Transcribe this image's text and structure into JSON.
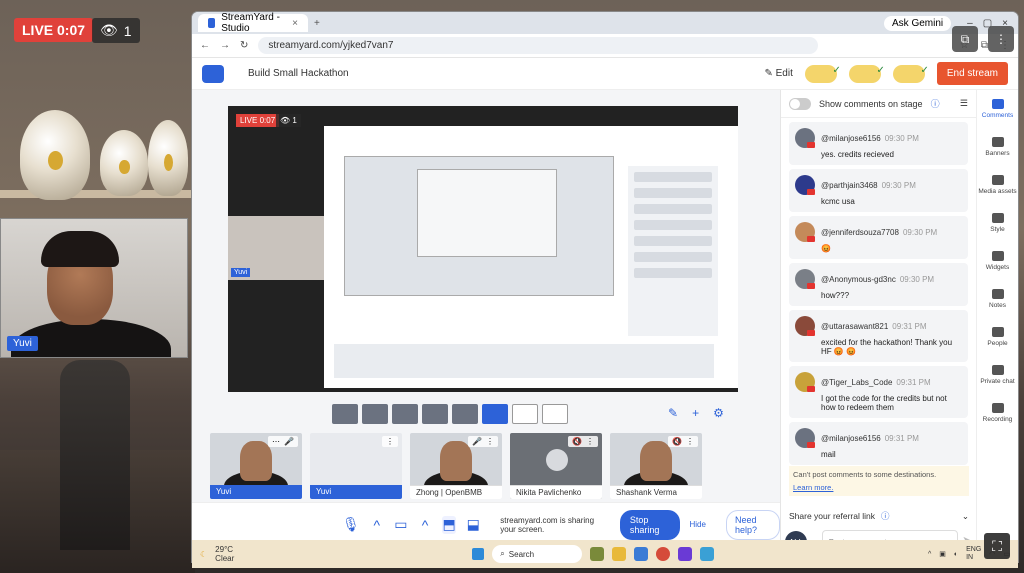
{
  "overlay": {
    "live_label": "LIVE 0:07",
    "viewer_count": "1",
    "cam_name": "Yuvi"
  },
  "browser": {
    "tab_title": "StreamYard - Studio",
    "ask_label": "Ask Gemini",
    "url": "streamyard.com/yjked7van7"
  },
  "studio": {
    "title": "Build Small Hackathon",
    "edit_label": "Edit",
    "end_stream_label": "End stream"
  },
  "stage": {
    "live_label": "LIVE 0:07",
    "viewer_count": "1",
    "cam_name": "Yuvi"
  },
  "guests": [
    {
      "name": "Yuvi",
      "highlight": true
    },
    {
      "name": "Yuvi",
      "highlight": true
    },
    {
      "name": "Zhong | OpenBMB",
      "highlight": false
    },
    {
      "name": "Nikita Pavlichenko",
      "highlight": false
    },
    {
      "name": "Shashank Verma",
      "highlight": false
    }
  ],
  "bottom_bar": {
    "share_message": "streamyard.com is sharing your screen.",
    "stop_sharing": "Stop sharing",
    "hide": "Hide",
    "need_help": "Need help?"
  },
  "chat": {
    "show_comments_label": "Show comments on stage",
    "messages": [
      {
        "user": "@milanjose6156",
        "time": "09:30 PM",
        "text": "yes. credits recieved"
      },
      {
        "user": "@parthjain3468",
        "time": "09:30 PM",
        "text": "kcmc usa"
      },
      {
        "user": "@jenniferdsouza7708",
        "time": "09:30 PM",
        "text": "😡"
      },
      {
        "user": "@Anonymous-gd3nc",
        "time": "09:30 PM",
        "text": "how???"
      },
      {
        "user": "@uttarasawant821",
        "time": "09:31 PM",
        "text": "excited for the hackathon! Thank you HF 😡 😡"
      },
      {
        "user": "@Tiger_Labs_Code",
        "time": "09:31 PM",
        "text": "I got the code for the credits but not how to redeem them"
      },
      {
        "user": "@milanjose6156",
        "time": "09:31 PM",
        "text": "mail"
      }
    ],
    "note": "Can't post comments to some destinations.",
    "learn_more": "Learn more.",
    "referral": "Share your referral link",
    "all_label": "ALL",
    "input_placeholder": "Post a comment"
  },
  "rail": [
    {
      "label": "Comments",
      "active": true
    },
    {
      "label": "Banners",
      "active": false
    },
    {
      "label": "Media assets",
      "active": false
    },
    {
      "label": "Style",
      "active": false
    },
    {
      "label": "Widgets",
      "active": false
    },
    {
      "label": "Notes",
      "active": false
    },
    {
      "label": "People",
      "active": false
    },
    {
      "label": "Private chat",
      "active": false
    },
    {
      "label": "Recording",
      "active": false
    }
  ],
  "taskbar": {
    "weather_temp": "29°C",
    "weather_desc": "Clear",
    "search": "Search",
    "lang_1": "ENG",
    "lang_2": "IN"
  },
  "colors": {
    "accent": "#2d62d8",
    "live": "#e0413a",
    "end_stream": "#e8552f"
  }
}
